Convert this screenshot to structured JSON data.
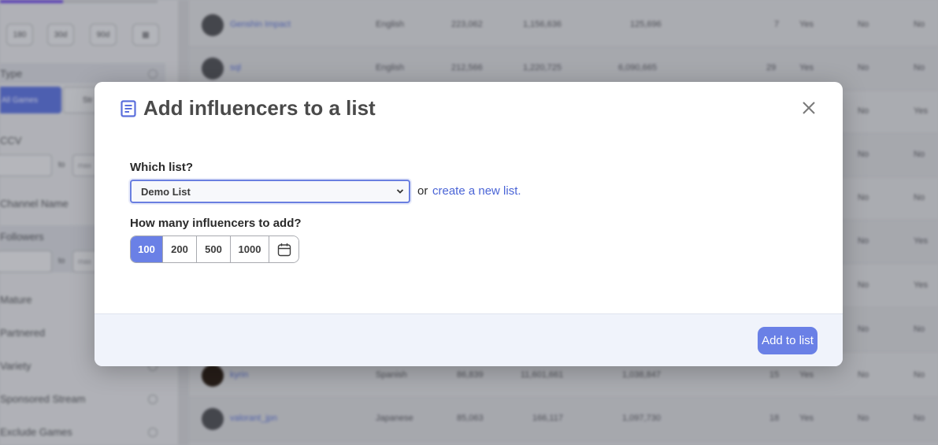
{
  "modal": {
    "title": "Add influencers to a list",
    "which_list_label": "Which list?",
    "selected_list": "Demo List",
    "or_text": "or",
    "create_link": "create a new list.",
    "count_label": "How many influencers to add?",
    "count_options": [
      "100",
      "200",
      "500",
      "1000"
    ],
    "count_selected": "100",
    "add_button": "Add to list"
  },
  "background": {
    "sidebar": {
      "date_buttons": [
        "180",
        "30d",
        "90d"
      ],
      "type_label": "Type",
      "type_options": [
        "All Games",
        "Str"
      ],
      "ccv_label": "CCV",
      "range_sep": "to",
      "range_placeholder": "max",
      "channel_name_label": "Channel Name",
      "followers_label": "Followers",
      "feature_labels": [
        "Mature",
        "Partnered",
        "Variety",
        "Sponsored Stream",
        "Exclude Games"
      ]
    },
    "rows": [
      {
        "name": "Genshin Impact",
        "lang": "English",
        "v1": "223,062",
        "v2": "1,156,636",
        "v3": "125,696",
        "v4": "7",
        "f1": "Yes",
        "f2": "No",
        "f3": "No"
      },
      {
        "name": "sql",
        "lang": "English",
        "v1": "212,566",
        "v2": "1,220,725",
        "v3": "6,090,665",
        "v4": "29",
        "f1": "Yes",
        "f2": "No",
        "f3": "No"
      },
      {
        "name": "kyrin",
        "lang": "Spanish",
        "v1": "86,839",
        "v2": "11,601,661",
        "v3": "1,038,847",
        "v4": "15",
        "f1": "Yes",
        "f2": "No",
        "f3": "No"
      },
      {
        "name": "valorant_jpn",
        "lang": "Japanese",
        "v1": "85,063",
        "v2": "166,117",
        "v3": "1,097,730",
        "v4": "18",
        "f1": "Yes",
        "f2": "No",
        "f3": "No"
      }
    ],
    "partial_flags": [
      {
        "f2": "No",
        "f3": "Yes"
      },
      {
        "f2": "No",
        "f3": "No"
      },
      {
        "f2": "No",
        "f3": "No"
      },
      {
        "f2": "No",
        "f3": "Yes"
      },
      {
        "f2": "No",
        "f3": "Yes"
      },
      {
        "f2": "No",
        "f3": "No"
      }
    ]
  }
}
